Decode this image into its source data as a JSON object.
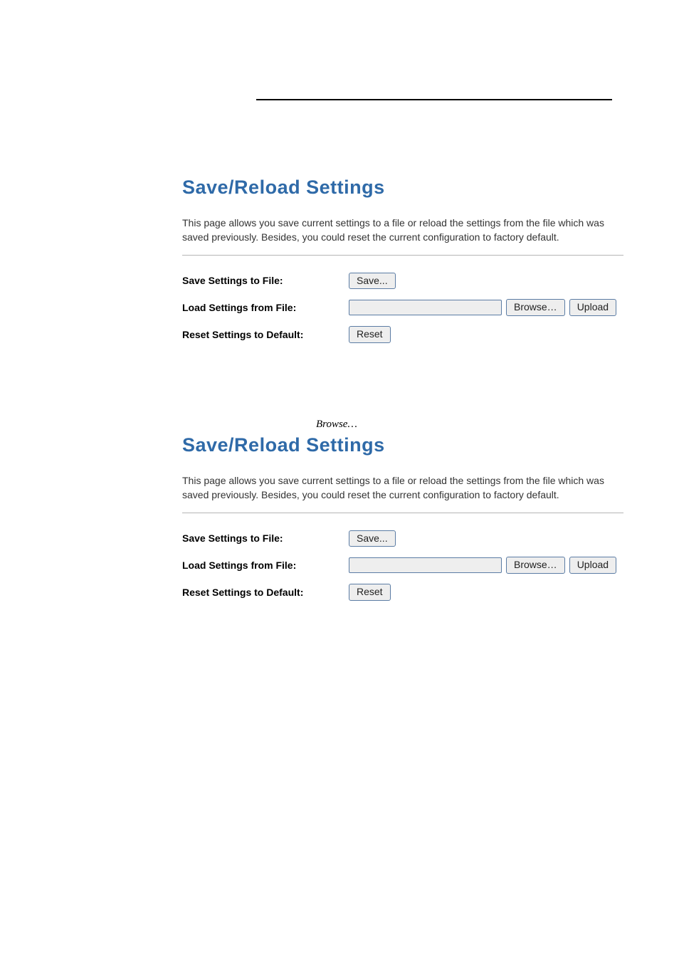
{
  "midtext": "Browse…",
  "panel1": {
    "title": "Save/Reload Settings",
    "description": "This page allows you save current settings to a file or reload the settings from the file which was saved previously. Besides, you could reset the current configuration to factory default.",
    "row_save_label": "Save Settings to File:",
    "row_load_label": "Load Settings from File:",
    "row_reset_label": "Reset Settings to Default:",
    "btn_save": "Save...",
    "btn_browse": "Browse…",
    "btn_upload": "Upload",
    "btn_reset": "Reset"
  },
  "panel2": {
    "title": "Save/Reload Settings",
    "description": "This page allows you save current settings to a file or reload the settings from the file which was saved previously. Besides, you could reset the current configuration to factory default.",
    "row_save_label": "Save Settings to File:",
    "row_load_label": "Load Settings from File:",
    "row_reset_label": "Reset Settings to Default:",
    "btn_save": "Save...",
    "btn_browse": "Browse…",
    "btn_upload": "Upload",
    "btn_reset": "Reset"
  }
}
